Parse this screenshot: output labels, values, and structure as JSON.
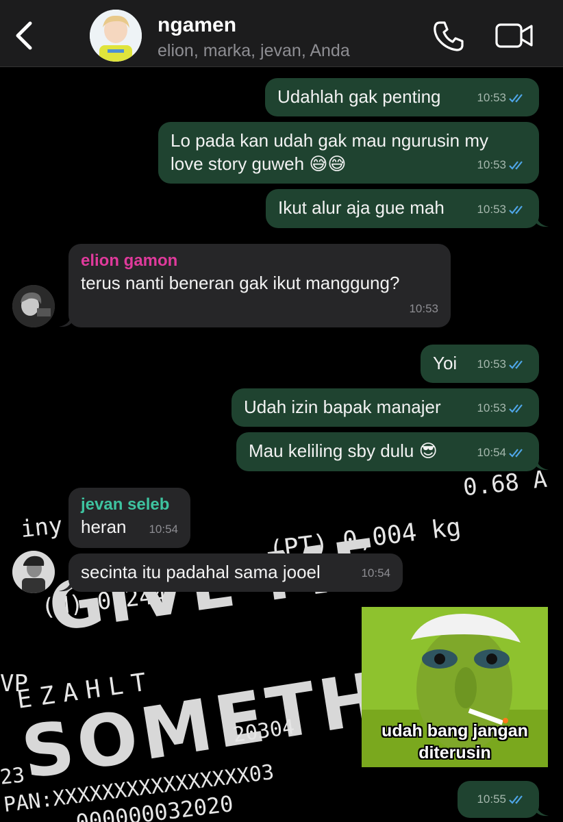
{
  "header": {
    "title": "ngamen",
    "subtitle": "elion, marka, jevan, Anda"
  },
  "colors": {
    "outgoing_bubble": "#1f4330",
    "incoming_bubble": "#262628",
    "read_ticks": "#4fa6e8",
    "sender_elion": "#e03a9c",
    "sender_jevan": "#3ec3a0"
  },
  "messages": [
    {
      "text": "Udahlah gak penting",
      "time": "10:53",
      "direction": "out",
      "status": "read"
    },
    {
      "text": "Lo pada kan udah gak mau ngurusin my love story guweh 😅😅",
      "line1": "Lo pada kan udah gak mau ngurusin my",
      "line2": "love story guweh 😅😅",
      "time": "10:53",
      "direction": "out",
      "status": "read"
    },
    {
      "text": "Ikut alur aja gue mah",
      "time": "10:53",
      "direction": "out",
      "status": "read"
    },
    {
      "sender": "elion gamon",
      "text": "terus nanti beneran gak ikut manggung?",
      "time": "10:53",
      "direction": "in"
    },
    {
      "text": "Yoi",
      "time": "10:53",
      "direction": "out",
      "status": "read"
    },
    {
      "text": "Udah izin bapak manajer",
      "time": "10:53",
      "direction": "out",
      "status": "read"
    },
    {
      "text": "Mau keliling sby dulu 😎",
      "time": "10:54",
      "direction": "out",
      "status": "read"
    },
    {
      "sender": "jevan seleb",
      "text": "heran",
      "time": "10:54",
      "direction": "in"
    },
    {
      "text": "secinta itu padahal sama jooel",
      "time": "10:54",
      "direction": "in"
    },
    {
      "sticker_caption_1": "udah bang jangan",
      "sticker_caption_2": "diterusin",
      "time": "10:55",
      "direction": "out",
      "status": "read"
    }
  ],
  "wallpaper": {
    "lines": [
      "0.68 A",
      "(PT) 0,004 kg",
      "(N) 0,244",
      "GIVE ME",
      "SOMETH",
      "EZAHLT",
      "VP",
      "20304",
      "PAN:XXXXXXXXXXXXXXXX03",
      "000000032020",
      "23",
      "iny"
    ]
  },
  "icons": {
    "back": "chevron-left-icon",
    "call": "phone-icon",
    "video": "video-camera-icon",
    "read": "double-check-icon"
  }
}
